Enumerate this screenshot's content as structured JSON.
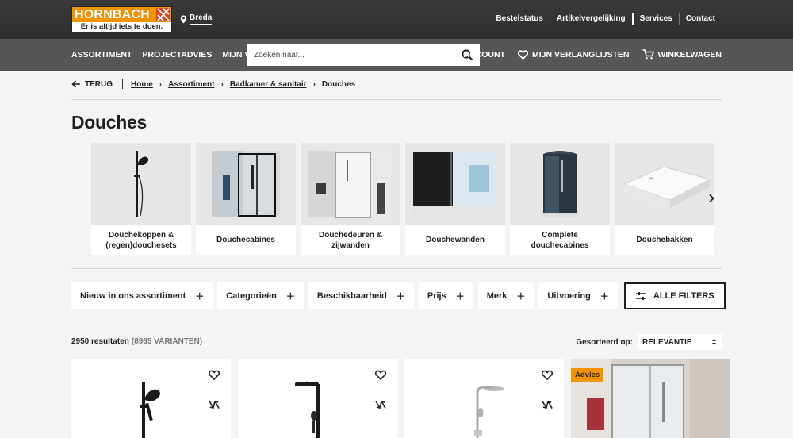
{
  "header": {
    "logo_brand": "HORNBACH",
    "logo_tagline": "Er is altijd iets te doen.",
    "location": "Breda",
    "top_links": [
      "Bestelstatus",
      "Artikelvergelijking",
      "Services",
      "Contact"
    ]
  },
  "nav": {
    "left": [
      "ASSORTIMENT",
      "PROJECTADVIES",
      "MIJN VESTIGING"
    ],
    "search_placeholder": "Zoeken naar...",
    "account": "MIJN ACCOUNT",
    "wishlist": "MIJN VERLANGLIJSTEN",
    "cart": "WINKELWAGEN"
  },
  "breadcrumb": {
    "back": "TERUG",
    "items": [
      "Home",
      "Assortiment",
      "Badkamer & sanitair"
    ],
    "current": "Douches"
  },
  "page_title": "Douches",
  "categories": [
    {
      "label": "Douchekoppen & (regen)douchesets"
    },
    {
      "label": "Douchecabines"
    },
    {
      "label": "Douchedeuren & zijwanden"
    },
    {
      "label": "Douchewanden"
    },
    {
      "label": "Complete douchecabines"
    },
    {
      "label": "Douchebakken"
    }
  ],
  "filters": [
    "Nieuw in ons assortiment",
    "Categorieën",
    "Beschikbaarheid",
    "Prijs",
    "Merk",
    "Uitvoering"
  ],
  "all_filters": "ALLE FILTERS",
  "results": {
    "count": "2950 resultaten",
    "variants": "(8965 VARIANTEN)"
  },
  "sort": {
    "label": "Gesorteerd op:",
    "value": "RELEVANTIE"
  },
  "products": [
    {
      "badge": ""
    },
    {
      "badge": ""
    },
    {
      "badge": ""
    },
    {
      "badge": "Advies"
    }
  ],
  "colors": {
    "brand_orange": "#f29300",
    "nav_gray": "#565656",
    "top_dark": "#333333"
  }
}
